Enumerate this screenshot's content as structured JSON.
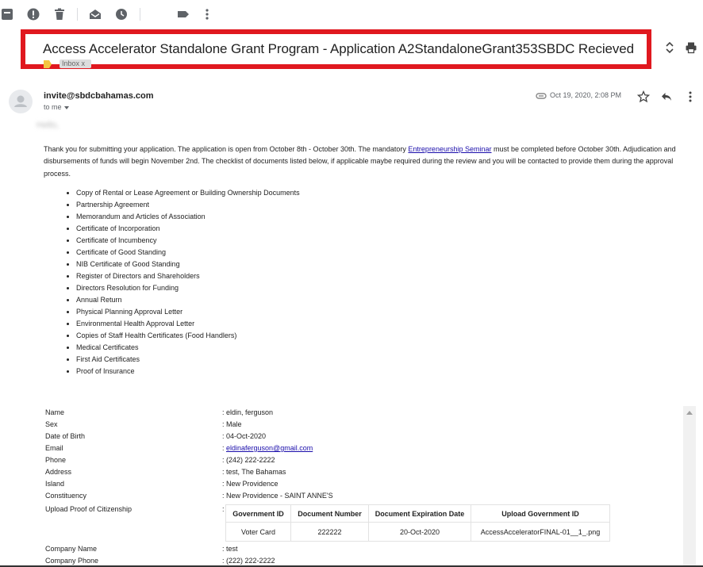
{
  "toolbar": {
    "icons": [
      "archive-icon",
      "report-spam-icon",
      "delete-icon",
      "mark-unread-icon",
      "snooze-icon",
      "label-icon",
      "more-vert-icon"
    ]
  },
  "email": {
    "subject": "Access Accelerator Standalone Grant Program - Application A2StandaloneGrant353SBDC Recieved",
    "folder_label": "Inbox x",
    "sender": "invite@sbdcbahamas.com",
    "to": "to me",
    "date": "Oct 19, 2020, 2:08 PM",
    "greeting": "Hello,",
    "body_pre_link": "Thank you for submitting your application. The application is open from October 8th - October 30th. The mandatory ",
    "body_link": "Entrepreneurship Seminar",
    "body_post_link": " must be completed before October 30th. Adjudication and disbursements of funds will begin November 2nd. The checklist of documents listed below, if applicable maybe required during the review and you will be contacted to provide them during the approval process.",
    "documents": [
      "Copy of Rental or Lease Agreement or Building Ownership Documents",
      "Partnership Agreement",
      "Memorandum and Articles of Association",
      "Certificate of Incorporation",
      "Certificate of Incumbency",
      "Certificate of Good Standing",
      "NIB Certificate of Good Standing",
      "Register of Directors and Shareholders",
      "Directors Resolution for Funding",
      "Annual Return",
      "Physical Planning Approval Letter",
      "Environmental Health Approval Letter",
      "Copies of Staff Health Certificates (Food Handlers)",
      "Medical Certificates",
      "First Aid Certificates",
      "Proof of Insurance"
    ]
  },
  "details": {
    "name_label": "Name",
    "name_value": ": eldin, ferguson",
    "sex_label": "Sex",
    "sex_value": ": Male",
    "dob_label": "Date of Birth",
    "dob_value": ": 04-Oct-2020",
    "email_label": "Email",
    "email_prefix": ": ",
    "email_value": "eldinaferguson@gmail.com",
    "phone_label": "Phone",
    "phone_value": ": (242) 222-2222",
    "address_label": "Address",
    "address_value": ": test, The Bahamas",
    "island_label": "Island",
    "island_value": ": New Providence",
    "constituency_label": "Constituency",
    "constituency_value": ": New Providence - SAINT ANNE'S",
    "upload_label": "Upload Proof of Citizenship",
    "upload_colon": ":",
    "gov_table": {
      "headers": [
        "Government ID",
        "Document Number",
        "Document Expiration Date",
        "Upload Government ID"
      ],
      "row": [
        "Voter Card",
        "222222",
        "20-Oct-2020",
        "AccessAcceleratorFINAL-01__1_.png"
      ]
    },
    "company_name_label": "Company Name",
    "company_name_value": ": test",
    "company_phone_label": "Company Phone",
    "company_phone_value": ": (222) 222-2222"
  }
}
